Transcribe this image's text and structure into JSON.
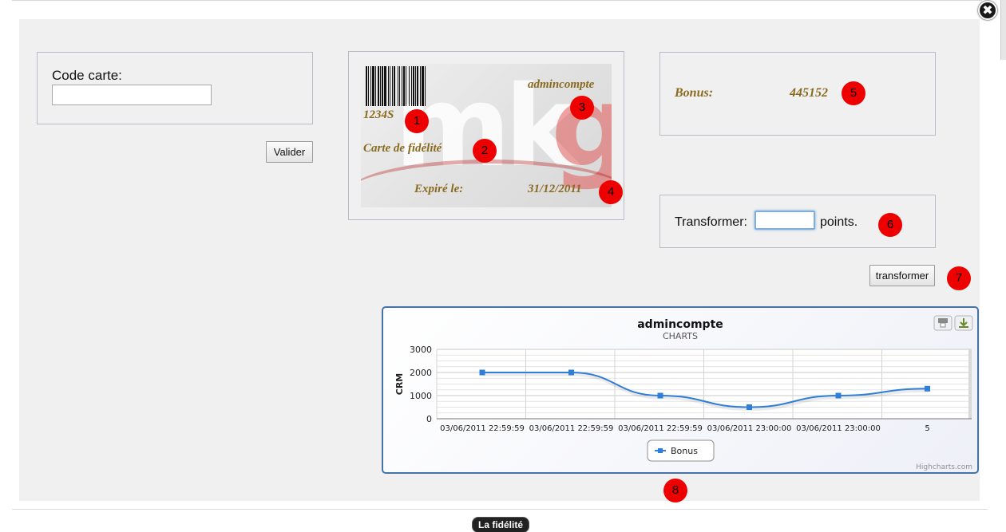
{
  "window": {
    "close_icon_glyph": "✖"
  },
  "card_form": {
    "code_label": "Code carte:",
    "code_value": "",
    "validate_label": "Valider"
  },
  "loyalty_card": {
    "number": "1234S",
    "title": "Carte de fidélité",
    "holder": "admincompte",
    "expiry_label": "Expiré le:",
    "expiry_date": "31/12/2011",
    "watermark": "mk",
    "watermark_accent": "g"
  },
  "bonus": {
    "label": "Bonus:",
    "value": "445152"
  },
  "transform": {
    "label": "Transformer:",
    "value": "",
    "unit": "points.",
    "button_label": "transformer"
  },
  "markers": [
    "1",
    "2",
    "3",
    "4",
    "5",
    "6",
    "7",
    "8"
  ],
  "chart_data": {
    "type": "line",
    "title": "admincompte",
    "subtitle": "CHARTS",
    "ylabel": "CRM",
    "xlabel": "",
    "ylim": [
      0,
      3000
    ],
    "yticks": [
      0,
      1000,
      2000,
      3000
    ],
    "categories": [
      "03/06/2011 22:59:59",
      "03/06/2011 22:59:59",
      "03/06/2011 22:59:59",
      "03/06/2011 23:00:00",
      "03/06/2011 23:00:00",
      "5"
    ],
    "series": [
      {
        "name": "Bonus",
        "values": [
          2000,
          2000,
          1000,
          500,
          1000,
          1300
        ],
        "color": "#2f7ed8"
      }
    ],
    "grid": true,
    "legend": "bottom-center",
    "credits": "Highcharts.com",
    "print_icon": "print-icon",
    "export_icon": "download-icon"
  },
  "footer": {
    "tab_label": "La fidélité"
  },
  "colors": {
    "panel_bg": "#f0f0f0",
    "card_text": "#8a6a1e",
    "marker": "#ee0000",
    "chart_border": "#4572a7"
  }
}
